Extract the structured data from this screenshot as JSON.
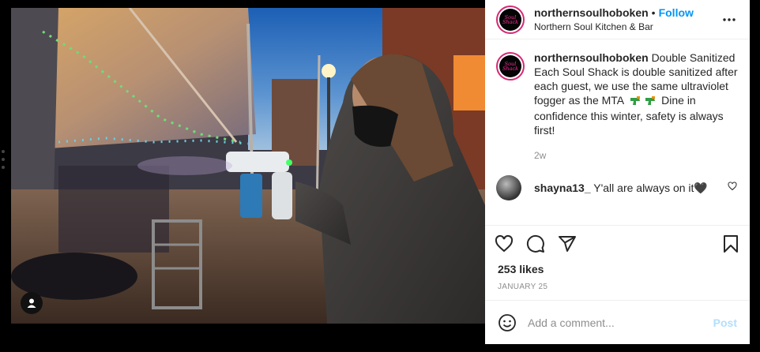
{
  "post": {
    "username": "northernsoulhoboken",
    "follow_label": "Follow",
    "location": "Northern Soul Kitchen & Bar",
    "avatar_text": "Soul Shack",
    "caption": "Double Sanitized Each Soul Shack is double sanitized after each guest, we use the same ultraviolet fogger as the MTA",
    "caption_tail": "Dine in confidence this winter, safety is always first!",
    "time": "2w",
    "likes": "253 likes",
    "date": "JANUARY 25"
  },
  "comment": {
    "username": "shayna13_",
    "text": "Y'all are always on it🖤"
  },
  "composer": {
    "placeholder": "Add a comment...",
    "post_label": "Post"
  },
  "icons": {
    "more": "more-horizontal-icon",
    "like": "heart-icon",
    "comment": "comment-icon",
    "share": "share-icon",
    "save": "bookmark-icon",
    "emoji": "smiley-icon",
    "user_tag": "user-icon",
    "caption_emoji": "water-gun-icon"
  },
  "colors": {
    "follow": "#0095f6",
    "post_disabled": "#b2dffc",
    "avatar_ring": "#d62976",
    "avatar_text": "#ff2e9a"
  }
}
